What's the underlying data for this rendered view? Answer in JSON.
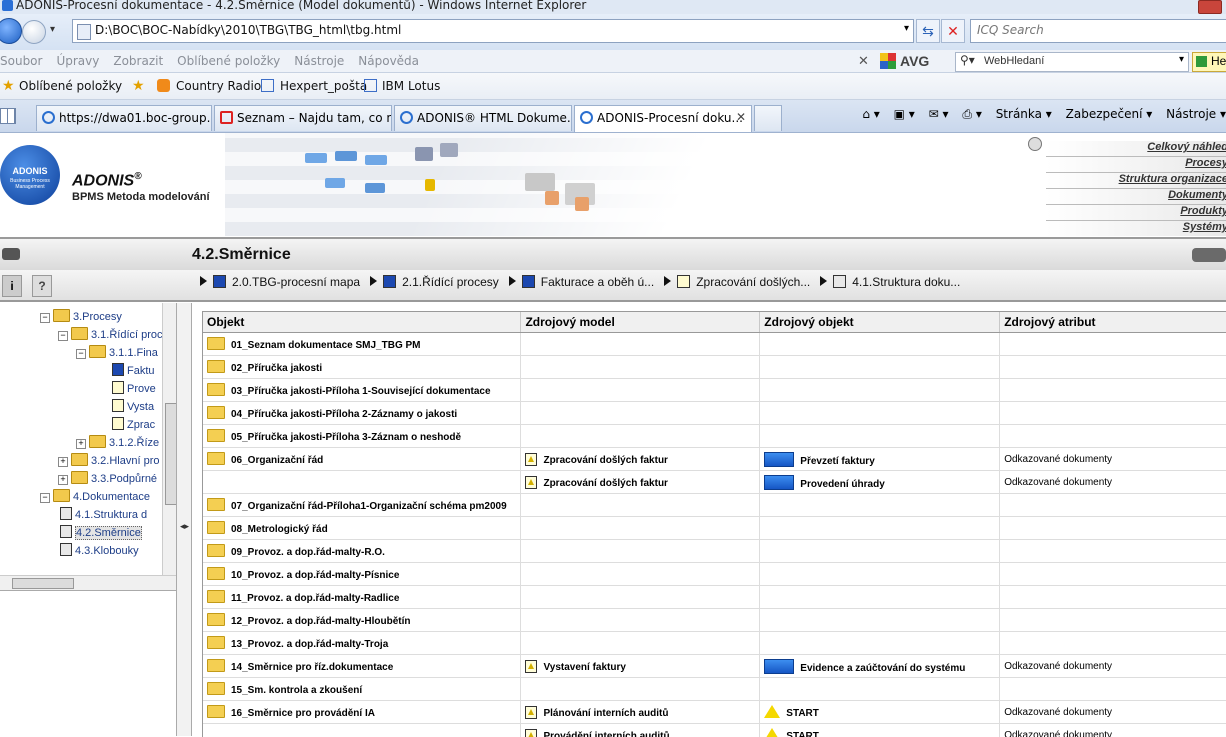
{
  "window": {
    "title": "ADONIS-Procesní dokumentace - 4.2.Směrnice (Model dokumentů) - Windows Internet Explorer"
  },
  "address": {
    "url": "D:\\BOC\\BOC-Nabídky\\2010\\TBG\\TBG_html\\tbg.html",
    "search_placeholder": "ICQ Search"
  },
  "menu": [
    "Soubor",
    "Úpravy",
    "Zobrazit",
    "Oblíbené položky",
    "Nástroje",
    "Nápověda"
  ],
  "toolbar": {
    "avg_label": "AVG",
    "websearch_label": "WebHledaní",
    "help_label": "He"
  },
  "favorites": [
    "Oblíbené položky",
    "Country Radio",
    "Hexpert_pošta",
    "IBM Lotus"
  ],
  "tabs": [
    "https://dwa01.boc-group....",
    "Seznam – Najdu tam, co n...",
    "ADONIS® HTML Dokume...",
    "ADONIS-Procesní doku..."
  ],
  "commands": [
    "Stránka ▾",
    "Zabezpečení ▾",
    "Nástroje ▾"
  ],
  "adonis": {
    "brand": "ADONIS",
    "reg": "®",
    "subtitle": "BPMS Metoda modelování",
    "logo_text": "ADONIS",
    "logo_sub": "Business Process Management"
  },
  "rightnav": [
    "Celkový náhled",
    "Procesy",
    "Struktura organizace",
    "Dokumenty",
    "Produkty",
    "Systémy"
  ],
  "page": {
    "title": "4.2.Směrnice"
  },
  "breadcrumb": [
    {
      "label": "2.0.TBG-procesní mapa",
      "icon": "process-model-icon"
    },
    {
      "label": "2.1.Řídící procesy",
      "icon": "process-model-icon"
    },
    {
      "label": "Fakturace a oběh ú...",
      "icon": "process-model-icon"
    },
    {
      "label": "Zpracování došlých...",
      "icon": "business-process-icon"
    },
    {
      "label": "4.1.Struktura doku...",
      "icon": "document-model-icon"
    }
  ],
  "tree": [
    {
      "label": "3.Procesy",
      "depth": 0,
      "type": "folder",
      "exp": "−"
    },
    {
      "label": "3.1.Řídící proc",
      "depth": 1,
      "type": "folder",
      "exp": "−"
    },
    {
      "label": "3.1.1.Fina",
      "depth": 2,
      "type": "folder",
      "exp": "−"
    },
    {
      "label": "Faktu",
      "depth": 3,
      "type": "process-model-icon"
    },
    {
      "label": "Prove",
      "depth": 3,
      "type": "business-process-icon"
    },
    {
      "label": "Vysta",
      "depth": 3,
      "type": "business-process-icon"
    },
    {
      "label": "Zprac",
      "depth": 3,
      "type": "business-process-icon"
    },
    {
      "label": "3.1.2.Říze",
      "depth": 2,
      "type": "folder",
      "exp": "+"
    },
    {
      "label": "3.2.Hlavní pro",
      "depth": 1,
      "type": "folder",
      "exp": "+"
    },
    {
      "label": "3.3.Podpůrné",
      "depth": 1,
      "type": "folder",
      "exp": "+"
    },
    {
      "label": "4.Dokumentace",
      "depth": 0,
      "type": "folder",
      "exp": "−"
    },
    {
      "label": "4.1.Struktura d",
      "depth": 1,
      "type": "document-model-icon"
    },
    {
      "label": "4.2.Směrnice",
      "depth": 1,
      "type": "document-model-icon",
      "selected": true
    },
    {
      "label": "4.3.Klobouky",
      "depth": 1,
      "type": "document-model-icon"
    }
  ],
  "table": {
    "headers": [
      "Objekt",
      "Zdrojový model",
      "Zdrojový objekt",
      "Zdrojový atribut"
    ],
    "rows": [
      {
        "obj": "01_Seznam dokumentace SMJ_TBG PM",
        "folder": true,
        "model": "",
        "src": "",
        "srcType": "",
        "att": ""
      },
      {
        "obj": "02_Příručka jakosti",
        "folder": true,
        "model": "",
        "src": "",
        "srcType": "",
        "att": ""
      },
      {
        "obj": "03_Příručka jakosti-Příloha 1-Související dokumentace",
        "folder": true,
        "model": "",
        "src": "",
        "srcType": "",
        "att": ""
      },
      {
        "obj": "04_Příručka jakosti-Příloha 2-Záznamy o jakosti",
        "folder": true,
        "model": "",
        "src": "",
        "srcType": "",
        "att": ""
      },
      {
        "obj": "05_Příručka jakosti-Příloha 3-Záznam o neshodě",
        "folder": true,
        "model": "",
        "src": "",
        "srcType": "",
        "att": ""
      },
      {
        "obj": "06_Organizační řád",
        "folder": true,
        "model": "Zpracování došlých faktur",
        "src": "Převzetí faktury",
        "srcType": "activity",
        "att": "Odkazované dokumenty"
      },
      {
        "obj": "",
        "folder": false,
        "model": "Zpracování došlých faktur",
        "src": "Provedení úhrady",
        "srcType": "activity",
        "att": "Odkazované dokumenty"
      },
      {
        "obj": "07_Organizační řád-Příloha1-Organizační schéma pm2009",
        "folder": true,
        "model": "",
        "src": "",
        "srcType": "",
        "att": ""
      },
      {
        "obj": "08_Metrologický řád",
        "folder": true,
        "model": "",
        "src": "",
        "srcType": "",
        "att": ""
      },
      {
        "obj": "09_Provoz. a dop.řád-malty-R.O.",
        "folder": true,
        "model": "",
        "src": "",
        "srcType": "",
        "att": ""
      },
      {
        "obj": "10_Provoz. a dop.řád-malty-Písnice",
        "folder": true,
        "model": "",
        "src": "",
        "srcType": "",
        "att": ""
      },
      {
        "obj": "11_Provoz. a dop.řád-malty-Radlice",
        "folder": true,
        "model": "",
        "src": "",
        "srcType": "",
        "att": ""
      },
      {
        "obj": "12_Provoz. a dop.řád-malty-Hloubětín",
        "folder": true,
        "model": "",
        "src": "",
        "srcType": "",
        "att": ""
      },
      {
        "obj": "13_Provoz. a dop.řád-malty-Troja",
        "folder": true,
        "model": "",
        "src": "",
        "srcType": "",
        "att": ""
      },
      {
        "obj": "14_Směrnice pro říz.dokumentace",
        "folder": true,
        "model": "Vystavení faktury",
        "src": "Evidence a zaúčtování do systému",
        "srcType": "activity",
        "att": "Odkazované dokumenty"
      },
      {
        "obj": "15_Sm. kontrola a zkoušení",
        "folder": true,
        "model": "",
        "src": "",
        "srcType": "",
        "att": ""
      },
      {
        "obj": "16_Směrnice pro provádění IA",
        "folder": true,
        "model": "Plánování interních auditů",
        "src": "START",
        "srcType": "start",
        "att": "Odkazované dokumenty"
      },
      {
        "obj": "",
        "folder": false,
        "model": "Provádění interních auditů",
        "src": "START",
        "srcType": "start",
        "att": "Odkazované dokumenty"
      }
    ]
  },
  "colors": {
    "accent_blue": "#1556c4",
    "folder_yellow": "#f4cf52",
    "start_yellow": "#f4d800"
  }
}
